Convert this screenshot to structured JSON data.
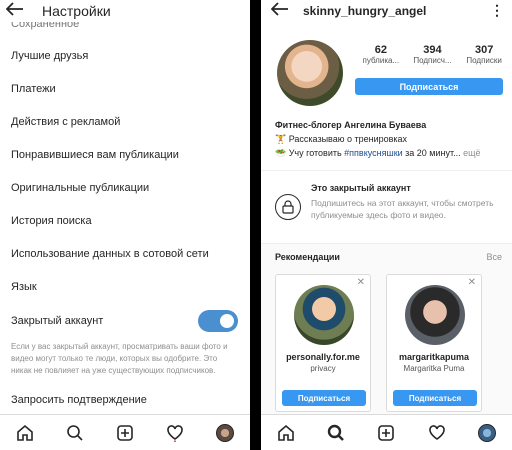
{
  "left": {
    "title": "Настройки",
    "cutoff_item": "Сохраненное",
    "items": [
      "Лучшие друзья",
      "Платежи",
      "Действия с рекламой",
      "Понравившиеся вам публикации",
      "Оригинальные публикации",
      "История поиска",
      "Использование данных в сотовой сети",
      "Язык"
    ],
    "private_label": "Закрытый аккаунт",
    "private_enabled": true,
    "private_note": "Если у вас закрытый аккаунт, просматривать ваши фото и видео могут только те люди, которых вы одобрите. Это никак не повлияет на уже существующих подписчиков.",
    "confirm_label": "Запросить подтверждение"
  },
  "right": {
    "username": "skinny_hungry_angel",
    "stats": [
      {
        "num": "62",
        "label": "публика..."
      },
      {
        "num": "394",
        "label": "Подписч..."
      },
      {
        "num": "307",
        "label": "Подписки"
      }
    ],
    "subscribe_label": "Подписаться",
    "bio_name": "Фитнес-блогер Ангелина Буваева",
    "bio_line1": "🏋 Рассказываю о тренировках",
    "bio_line2_prefix": "🥗 Учу готовить ",
    "bio_hashtag": "#ппвкусняшки",
    "bio_line2_suffix": " за 20 минут...",
    "bio_more": "ещё",
    "private_title": "Это закрытый аккаунт",
    "private_desc": "Подпишитесь на этот аккаунт, чтобы смотреть публикуемые здесь фото и видео.",
    "recs_title": "Рекомендации",
    "recs_all": "Все",
    "cards": [
      {
        "username": "personally.for.me",
        "sub": "privacy",
        "button": "Подписаться"
      },
      {
        "username": "margaritkapuma",
        "sub": "Margaritka Puma",
        "button": "Подписаться"
      }
    ]
  },
  "icons": [
    "back-arrow-icon",
    "home-icon",
    "search-icon",
    "add-icon",
    "heart-icon",
    "profile-icon",
    "lock-icon",
    "close-icon",
    "more-icon"
  ],
  "colors": {
    "accent": "#3897f0",
    "toggle": "#4a8fcf",
    "hashtag": "#1a4d8f"
  }
}
